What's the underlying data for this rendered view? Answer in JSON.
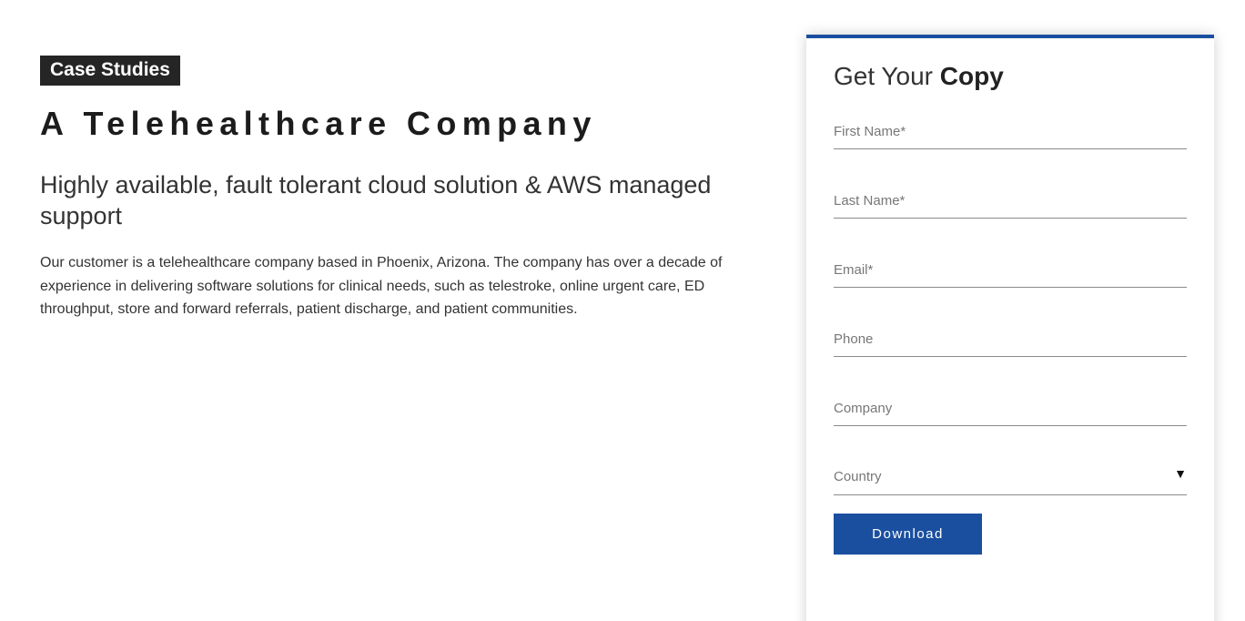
{
  "hero": {
    "tag": "Case Studies",
    "title": "A Telehealthcare Company",
    "subtitle": "Highly available, fault tolerant cloud solution & AWS managed support",
    "description": "Our customer is a telehealthcare company based in Phoenix, Arizona. The company has over a decade of experience in delivering software solutions for clinical needs, such as telestroke, online urgent care, ED throughput, store and forward referrals, patient discharge, and patient communities."
  },
  "form": {
    "title_prefix": "Get Your ",
    "title_bold": "Copy",
    "fields": {
      "first_name": {
        "placeholder": "First Name*"
      },
      "last_name": {
        "placeholder": "Last Name*"
      },
      "email": {
        "placeholder": "Email*"
      },
      "phone": {
        "placeholder": "Phone"
      },
      "company": {
        "placeholder": "Company"
      },
      "country": {
        "value": "Country",
        "arrow": "▼"
      }
    },
    "submit_label": "Download"
  },
  "colors": {
    "accent": "#1a4fa0",
    "tag_bg": "#252525"
  }
}
